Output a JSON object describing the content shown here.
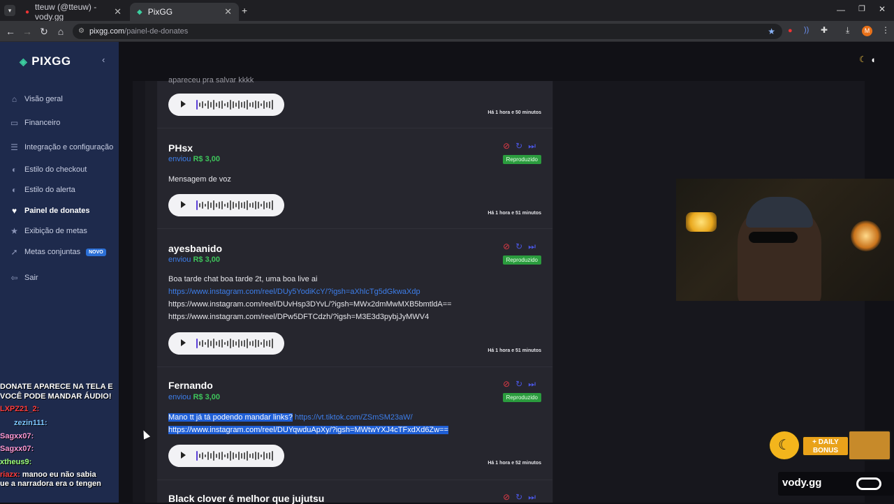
{
  "browser": {
    "tabs": [
      {
        "label": "tteuw (@tteuw) - vody.gg",
        "active": false
      },
      {
        "label": "PixGG",
        "active": true
      }
    ],
    "url_domain": "pixgg.com",
    "url_path": "/painel-de-donates",
    "profile_initial": "M"
  },
  "sidebar": {
    "logo": "PIXGG",
    "items": [
      {
        "label": "Visão geral",
        "icon": "home-icon"
      },
      {
        "label": "Financeiro",
        "icon": "wallet-icon"
      },
      {
        "label": "Integração e configuração",
        "icon": "settings-icon"
      },
      {
        "label": "Estilo do checkout",
        "icon": "palette-icon"
      },
      {
        "label": "Estilo do alerta",
        "icon": "palette-icon"
      },
      {
        "label": "Painel de donates",
        "icon": "donate-icon",
        "active": true
      },
      {
        "label": "Exibição de metas",
        "icon": "star-icon"
      },
      {
        "label": "Metas conjuntas",
        "icon": "rocket-icon",
        "badge": "NOVO"
      },
      {
        "label": "Sair",
        "icon": "logout-icon"
      }
    ]
  },
  "donations": [
    {
      "partial_message": "apareceu pra salvar kkkk",
      "time": "Há 1 hora e 50 minutos"
    },
    {
      "name": "PHsx",
      "sent_label": "enviou",
      "amount": "R$ 3,00",
      "status": "Reproduzido",
      "message_lines": [
        "Mensagem de voz"
      ],
      "time": "Há 1 hora e 51 minutos"
    },
    {
      "name": "ayesbanido",
      "sent_label": "enviou",
      "amount": "R$ 3,00",
      "status": "Reproduzido",
      "message_lines": [
        "Boa tarde chat boa tarde 2t, uma boa live ai",
        "https://www.instagram.com/reel/DUy5YodiKcY/?igsh=aXhlcTg5dGkwaXdp",
        "https://www.instagram.com/reel/DUvHsp3DYvL/?igsh=MWx2dmMwMXB5bmtldA==",
        "https://www.instagram.com/reel/DPw5DFTCdzh/?igsh=M3E3d3pybjJyMWV4"
      ],
      "time": "Há 1 hora e 51 minutos"
    },
    {
      "name": "Fernando",
      "sent_label": "enviou",
      "amount": "R$ 3,00",
      "status": "Reproduzido",
      "message_text": "Mano tt já tá podendo mandar links?",
      "message_link": "https://vt.tiktok.com/ZSmSM23aW/",
      "message_line2": "https://www.instagram.com/reel/DUYqwduApXy/?igsh=MWtwYXJ4cTFxdXd6Zw==",
      "time": "Há 1 hora e 52 minutos"
    },
    {
      "name": "Black clover é melhor que jujutsu"
    }
  ],
  "overlay": {
    "chat": [
      {
        "user": "",
        "text": "DONATE APARECE NA TELA E"
      },
      {
        "user": "",
        "text": "VOCÊ PODE MANDAR ÁUDIO!"
      },
      {
        "user": "LXPZ21_2:",
        "text": ""
      },
      {
        "user": "zezin111:",
        "text": ""
      },
      {
        "user": "Sagxx07:",
        "text": ""
      },
      {
        "user": "Sagxx07:",
        "text": ""
      },
      {
        "user": "xtheus9:",
        "text": ""
      },
      {
        "user": "riazx:",
        "text": "manoo eu não sabia"
      },
      {
        "user": "",
        "text": "ue a narradora era o tengen"
      }
    ],
    "sticker_top": "+ DAILY",
    "sticker_bottom": "BONUS",
    "brand": "vody.gg"
  }
}
